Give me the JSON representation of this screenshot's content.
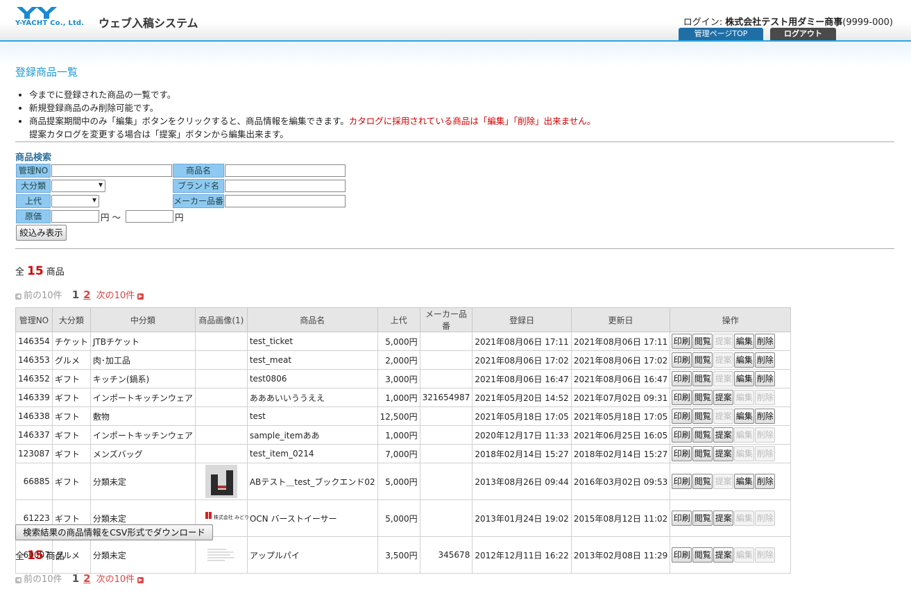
{
  "header": {
    "logo_text": "Y-YACHT Co., Ltd.",
    "system_title": "ウェブ入稿システム",
    "login_prefix": "ログイン:",
    "company": "株式会社テスト用ダミー商事",
    "company_code": "(9999-000)",
    "nav_admin": "管理ページTOP",
    "nav_logout": "ログアウト",
    "colors": {
      "accent": "#29a6e0",
      "admin_tab": "#1f6fa6",
      "logout_tab": "#4a4a4a"
    }
  },
  "page_title": "登録商品一覧",
  "notes": {
    "n1": "今までに登録された商品の一覧です。",
    "n2": "新規登録商品のみ削除可能です。",
    "n3a": "商品提案期間中のみ「編集」ボタンをクリックすると、商品情報を編集できます。",
    "n3b": "カタログに採用されている商品は「編集」「削除」出来ません。",
    "n3c": "提案カタログを変更する場合は「提案」ボタンから編集出来ます。"
  },
  "search": {
    "title": "商品検索",
    "label_no": "管理NO",
    "label_name": "商品名",
    "label_category": "大分類",
    "label_brand": "ブランド名",
    "label_retail": "上代",
    "label_maker": "メーカー品番",
    "label_cost": "原価",
    "yen": "円",
    "tilde": "〜",
    "no_value": "",
    "name_value": "",
    "brand_value": "",
    "maker_value": "",
    "cost_from": "",
    "cost_to": "",
    "category_selected": "",
    "retail_selected": "",
    "submit": "絞込み表示"
  },
  "summary": {
    "prefix": "全",
    "count": "15",
    "suffix": "商品"
  },
  "pager": {
    "prev": "前の10件",
    "current": "1",
    "page2": "2",
    "next": "次の10件"
  },
  "table": {
    "headers": [
      "管理NO",
      "大分類",
      "中分類",
      "商品画像(1)",
      "商品名",
      "上代",
      "メーカー品番",
      "登録日",
      "更新日",
      "操作"
    ],
    "op_labels": {
      "print": "印刷",
      "view": "閲覧",
      "propose": "提案",
      "edit": "編集",
      "delete": "削除"
    },
    "rows": [
      {
        "no": "146354",
        "cat": "チケット",
        "sub": "JTBチケット",
        "img": "",
        "name": "test_ticket",
        "price": "5,000円",
        "maker": "",
        "created": "2021年08月06日  17:11",
        "updated": "2021年08月06日  17:11",
        "ops": {
          "propose": false,
          "edit": true,
          "delete": true
        }
      },
      {
        "no": "146353",
        "cat": "グルメ",
        "sub": "肉･加工品",
        "img": "",
        "name": "test_meat",
        "price": "2,000円",
        "maker": "",
        "created": "2021年08月06日  17:02",
        "updated": "2021年08月06日  17:02",
        "ops": {
          "propose": false,
          "edit": true,
          "delete": true
        }
      },
      {
        "no": "146352",
        "cat": "ギフト",
        "sub": "キッチン(鍋系)",
        "img": "",
        "name": "test0806",
        "price": "3,000円",
        "maker": "",
        "created": "2021年08月06日  16:47",
        "updated": "2021年08月06日  16:47",
        "ops": {
          "propose": false,
          "edit": true,
          "delete": true
        }
      },
      {
        "no": "146339",
        "cat": "ギフト",
        "sub": "インポートキッチンウェア",
        "img": "",
        "name": "あああいいううええ",
        "price": "1,000円",
        "maker": "321654987",
        "created": "2021年05月20日  14:52",
        "updated": "2021年07月02日  09:31",
        "ops": {
          "propose": true,
          "edit": false,
          "delete": false
        }
      },
      {
        "no": "146338",
        "cat": "ギフト",
        "sub": "敷物",
        "img": "",
        "name": "test",
        "price": "12,500円",
        "maker": "",
        "created": "2021年05月18日  17:05",
        "updated": "2021年05月18日  17:05",
        "ops": {
          "propose": false,
          "edit": true,
          "delete": true
        }
      },
      {
        "no": "146337",
        "cat": "ギフト",
        "sub": "インポートキッチンウェア",
        "img": "",
        "name": "sample_itemああ",
        "price": "1,000円",
        "maker": "",
        "created": "2020年12月17日  11:33",
        "updated": "2021年06月25日  16:05",
        "ops": {
          "propose": true,
          "edit": false,
          "delete": false
        }
      },
      {
        "no": "123087",
        "cat": "ギフト",
        "sub": "メンズバッグ",
        "img": "",
        "name": "test_item_0214",
        "price": "7,000円",
        "maker": "",
        "created": "2018年02月14日  15:27",
        "updated": "2018年02月14日  15:27",
        "ops": {
          "propose": true,
          "edit": false,
          "delete": false
        }
      },
      {
        "no": "66885",
        "cat": "ギフト",
        "sub": "分類未定",
        "img": "bookend",
        "name": "ABテスト＿test_ブックエンド02",
        "price": "5,000円",
        "maker": "",
        "created": "2013年08月26日  09:44",
        "updated": "2016年03月02日  09:53",
        "ops": {
          "propose": false,
          "edit": true,
          "delete": true
        }
      },
      {
        "no": "61223",
        "cat": "ギフト",
        "sub": "分類未定",
        "img": "logo",
        "img_text": "株式会社 みどり",
        "name": "OCN バーストイーサー",
        "price": "5,000円",
        "maker": "",
        "created": "2013年01月24日  19:02",
        "updated": "2015年08月12日  11:02",
        "ops": {
          "propose": true,
          "edit": false,
          "delete": false
        }
      },
      {
        "no": "60007",
        "cat": "グルメ",
        "sub": "分類未定",
        "img": "doc",
        "name": "アップルパイ",
        "price": "3,500円",
        "maker": "345678",
        "created": "2012年12月11日  16:22",
        "updated": "2013年02月08日  11:29",
        "ops": {
          "propose": true,
          "edit": false,
          "delete": false
        }
      }
    ]
  },
  "csv_button": "検索結果の商品情報をCSV形式でダウンロード"
}
